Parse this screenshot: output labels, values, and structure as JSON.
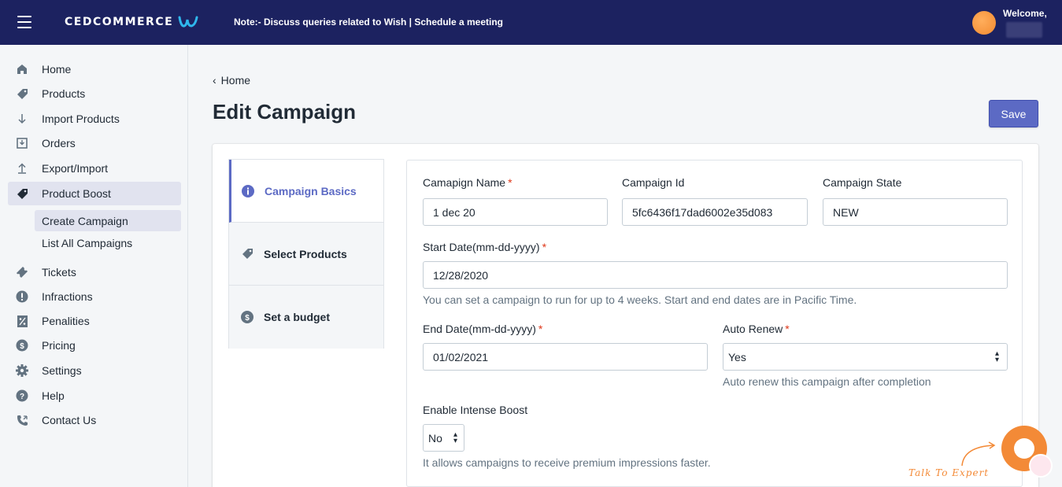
{
  "header": {
    "logo_text": "CEDCOMMERCE",
    "note_prefix": "Note:- Discuss queries related to Wish",
    "note_separator": " | ",
    "note_link": "Schedule a meeting",
    "welcome": "Welcome,"
  },
  "sidebar": {
    "items": [
      {
        "label": "Home",
        "icon": "home-icon"
      },
      {
        "label": "Products",
        "icon": "tag-icon"
      },
      {
        "label": "Import Products",
        "icon": "arrow-down-icon"
      },
      {
        "label": "Orders",
        "icon": "orders-inbox-icon"
      },
      {
        "label": "Export/Import",
        "icon": "upload-icon"
      },
      {
        "label": "Product Boost",
        "icon": "tag-icon"
      },
      {
        "label": "Tickets",
        "icon": "ticket-icon"
      },
      {
        "label": "Infractions",
        "icon": "alert-icon"
      },
      {
        "label": "Penalities",
        "icon": "percent-icon"
      },
      {
        "label": "Pricing",
        "icon": "dollar-icon"
      },
      {
        "label": "Settings",
        "icon": "gear-icon"
      },
      {
        "label": "Help",
        "icon": "help-icon"
      },
      {
        "label": "Contact Us",
        "icon": "phone-icon"
      }
    ],
    "sub_items": [
      {
        "label": "Create Campaign"
      },
      {
        "label": "List All Campaigns"
      }
    ]
  },
  "main": {
    "breadcrumb": "Home",
    "title": "Edit Campaign",
    "save_label": "Save",
    "steps": [
      {
        "label": "Campaign Basics",
        "icon": "info-icon"
      },
      {
        "label": "Select Products",
        "icon": "tag-icon"
      },
      {
        "label": "Set a budget",
        "icon": "dollar-icon"
      }
    ],
    "form": {
      "campaign_name_label": "Camapign Name",
      "campaign_name_value": "1 dec 20",
      "campaign_id_label": "Campaign Id",
      "campaign_id_value": "5fc6436f17dad6002e35d083",
      "campaign_state_label": "Campaign State",
      "campaign_state_value": "NEW",
      "start_date_label": "Start Date(mm-dd-yyyy)",
      "start_date_value": "12/28/2020",
      "start_date_help": "You can set a campaign to run for up to 4 weeks. Start and end dates are in Pacific Time.",
      "end_date_label": "End Date(mm-dd-yyyy)",
      "end_date_value": "01/02/2021",
      "auto_renew_label": "Auto Renew",
      "auto_renew_value": "Yes",
      "auto_renew_help": "Auto renew this campaign after completion",
      "intense_boost_label": "Enable Intense Boost",
      "intense_boost_value": "No",
      "intense_boost_help": "It allows campaigns to receive premium impressions faster.",
      "required_mark": "*"
    }
  },
  "chat": {
    "talk_label": "Talk To Expert"
  },
  "colors": {
    "header_bg": "#1c2260",
    "accent": "#5c6ac4",
    "chat": "#f38a37",
    "required": "#de3618"
  }
}
